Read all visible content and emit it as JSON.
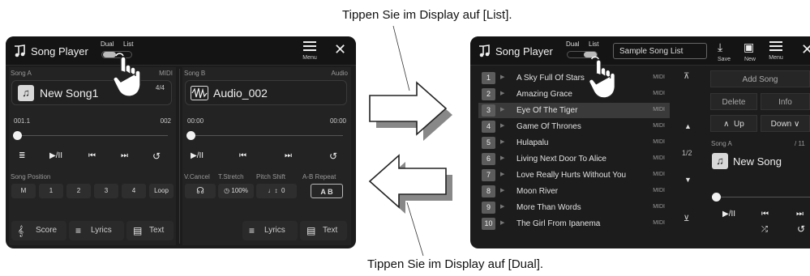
{
  "captions": {
    "top": "Tippen Sie im Display auf [List].",
    "bottom": "Tippen Sie im Display auf [Dual]."
  },
  "colors": {
    "screen_bg": "#1c1c1c",
    "panel_bg": "#232323",
    "selected_row": "#3a3a3a",
    "text": "#e6e6e6"
  },
  "left_screen": {
    "title": "Song Player",
    "mode_tabs": [
      "Dual",
      "List"
    ],
    "menu_label": "Menu",
    "song_a": {
      "label": "Song A",
      "format": "MIDI",
      "time_sig": "4/4",
      "name": "New Song1",
      "position_start": "001.1",
      "position_end": "002"
    },
    "song_b": {
      "label": "Song B",
      "format": "Audio",
      "name": "Audio_002",
      "time_start": "00:00",
      "time_end": "00:00"
    },
    "song_position": {
      "label": "Song Position",
      "buttons": [
        "M",
        "1",
        "2",
        "3",
        "4",
        "Loop"
      ]
    },
    "audio_controls": {
      "labels": [
        "V.Cancel",
        "T.Stretch",
        "Pitch Shift",
        "A-B Repeat"
      ],
      "values": [
        "100%",
        "0",
        "A B"
      ]
    },
    "bottom_buttons_a": [
      "Score",
      "Lyrics",
      "Text"
    ],
    "bottom_buttons_b": [
      "Lyrics",
      "Text"
    ]
  },
  "right_screen": {
    "title": "Song Player",
    "mode_tabs": [
      "Dual",
      "List"
    ],
    "list_name": "Sample Song List",
    "tools": [
      "Save",
      "New",
      "Menu"
    ],
    "songs": [
      {
        "num": "1",
        "name": "A Sky Full Of Stars",
        "format": "MIDI"
      },
      {
        "num": "2",
        "name": "Amazing Grace",
        "format": "MIDI"
      },
      {
        "num": "3",
        "name": "Eye Of The Tiger",
        "format": "MIDI"
      },
      {
        "num": "4",
        "name": "Game Of Thrones",
        "format": "MIDI"
      },
      {
        "num": "5",
        "name": "Hulapalu",
        "format": "MIDI"
      },
      {
        "num": "6",
        "name": "Living Next Door To Alice",
        "format": "MIDI"
      },
      {
        "num": "7",
        "name": "Love Really Hurts Without You",
        "format": "MIDI"
      },
      {
        "num": "8",
        "name": "Moon River",
        "format": "MIDI"
      },
      {
        "num": "9",
        "name": "More Than Words",
        "format": "MIDI"
      },
      {
        "num": "10",
        "name": "The Girl From Ipanema",
        "format": "MIDI"
      }
    ],
    "page_indicator": "1/2",
    "actions": {
      "add_song": "Add Song",
      "delete": "Delete",
      "info": "Info",
      "up": "Up",
      "down": "Down"
    },
    "song_a": {
      "label": "Song A",
      "counter": "/ 11",
      "name": "New Song"
    }
  }
}
